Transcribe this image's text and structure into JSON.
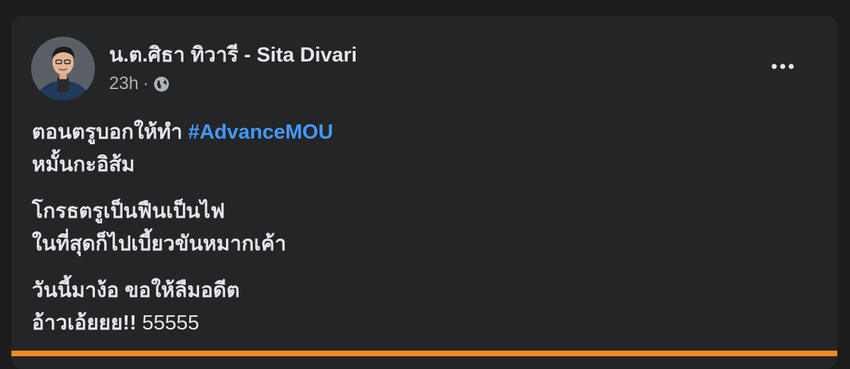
{
  "post": {
    "author": "น.ต.ศิธา ทิวารี - Sita Divari",
    "timestamp": "23h",
    "separator": "·",
    "audience_icon": "globe-icon",
    "more_icon": "more-options-icon",
    "paragraph1": {
      "line1_text": "ตอนตรูบอกให้ทำ",
      "hashtag": "#AdvanceMOU",
      "line2": "หมั้นกะอิส้ม"
    },
    "paragraph2": {
      "line1": "โกรธตรูเป็นฟืนเป็นไฟ",
      "line2": "ในที่สุดก็ไปเบี้ยวขันหมากเค้า"
    },
    "paragraph3": {
      "line1": "วันนี้มาง้อ ขอให้ลืมอดีต",
      "line2_text": "อ้าวเอ้ยยย!!",
      "line2_number": "55555"
    }
  },
  "colors": {
    "background": "#1c1c1c",
    "card": "#242526",
    "text": "#e4e6eb",
    "secondary_text": "#b0b3b8",
    "hashtag": "#4599ff",
    "accent_strip": "#f08a24"
  }
}
